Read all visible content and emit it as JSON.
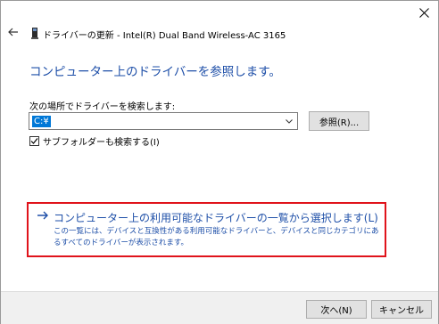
{
  "window": {
    "title": "ドライバーの更新 - Intel(R) Dual Band Wireless-AC 3165"
  },
  "main": {
    "heading": "コンピューター上のドライバーを参照します。",
    "location_label": "次の場所でドライバーを検索します:",
    "path_value": "C:¥",
    "browse_label": "参照(R)...",
    "subfolders_label": "サブフォルダーも検索する(I)",
    "subfolders_checked": true
  },
  "option": {
    "title": "コンピューター上の利用可能なドライバーの一覧から選択します(L)",
    "description": "この一覧には、デバイスと互換性がある利用可能なドライバーと、デバイスと同じカテゴリにあるすべてのドライバーが表示されます。"
  },
  "footer": {
    "next_label": "次へ(N)",
    "cancel_label": "キャンセル"
  },
  "colors": {
    "link_blue": "#1e4fa8",
    "highlight_red": "#e0131b",
    "selection_blue": "#0078d7"
  }
}
